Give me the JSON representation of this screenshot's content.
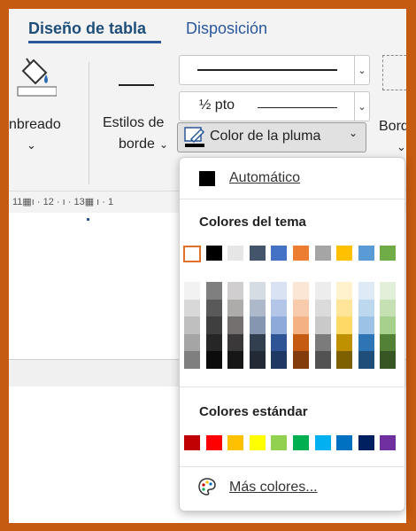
{
  "tabs": {
    "design": "Diseño de tabla",
    "layout": "Disposición"
  },
  "ribbon": {
    "shading_label": "nbreado",
    "border_styles_line1": "Estilos de",
    "border_styles_line2": "borde",
    "line_weight": "½ pto",
    "pen_color_label": "Color de la pluma",
    "borders_label": "Borde",
    "chevron": "⌄"
  },
  "ruler": {
    "text": "11▦ı · 12 · ı · 13▦ ı · 1"
  },
  "menu": {
    "automatic": "Automático",
    "theme_colors_header": "Colores del tema",
    "standard_colors_header": "Colores estándar",
    "more_colors": "Más colores...",
    "theme_top_row": [
      "#ffffff",
      "#000000",
      "#e7e6e6",
      "#44546a",
      "#4472c4",
      "#ed7d31",
      "#a5a5a5",
      "#ffc000",
      "#5b9bd5",
      "#70ad47"
    ],
    "theme_shades": [
      [
        "#f2f2f2",
        "#7f7f7f",
        "#d0cece",
        "#d6dce4",
        "#d9e2f3",
        "#fbe5d5",
        "#ededed",
        "#fff2cc",
        "#deebf6",
        "#e2efd9"
      ],
      [
        "#d8d8d8",
        "#595959",
        "#aeabab",
        "#adb9ca",
        "#b4c6e7",
        "#f7cbac",
        "#dbdbdb",
        "#fee599",
        "#bdd7ee",
        "#c5e0b3"
      ],
      [
        "#bfbfbf",
        "#3f3f3f",
        "#757070",
        "#8496b0",
        "#8eaadb",
        "#f4b183",
        "#c9c9c9",
        "#ffd965",
        "#9cc3e5",
        "#a8d08d"
      ],
      [
        "#a5a5a5",
        "#262626",
        "#3a3838",
        "#323f4f",
        "#2f5496",
        "#c55a11",
        "#7b7b7b",
        "#bf9000",
        "#2e75b5",
        "#538135"
      ],
      [
        "#7f7f7f",
        "#0c0c0c",
        "#171616",
        "#222a35",
        "#1f3864",
        "#833c0b",
        "#525252",
        "#7f6000",
        "#1e4e79",
        "#375623"
      ]
    ],
    "standard": [
      "#c00000",
      "#ff0000",
      "#ffc000",
      "#ffff00",
      "#92d050",
      "#00b050",
      "#00b0f0",
      "#0070c0",
      "#002060",
      "#7030a0"
    ]
  }
}
